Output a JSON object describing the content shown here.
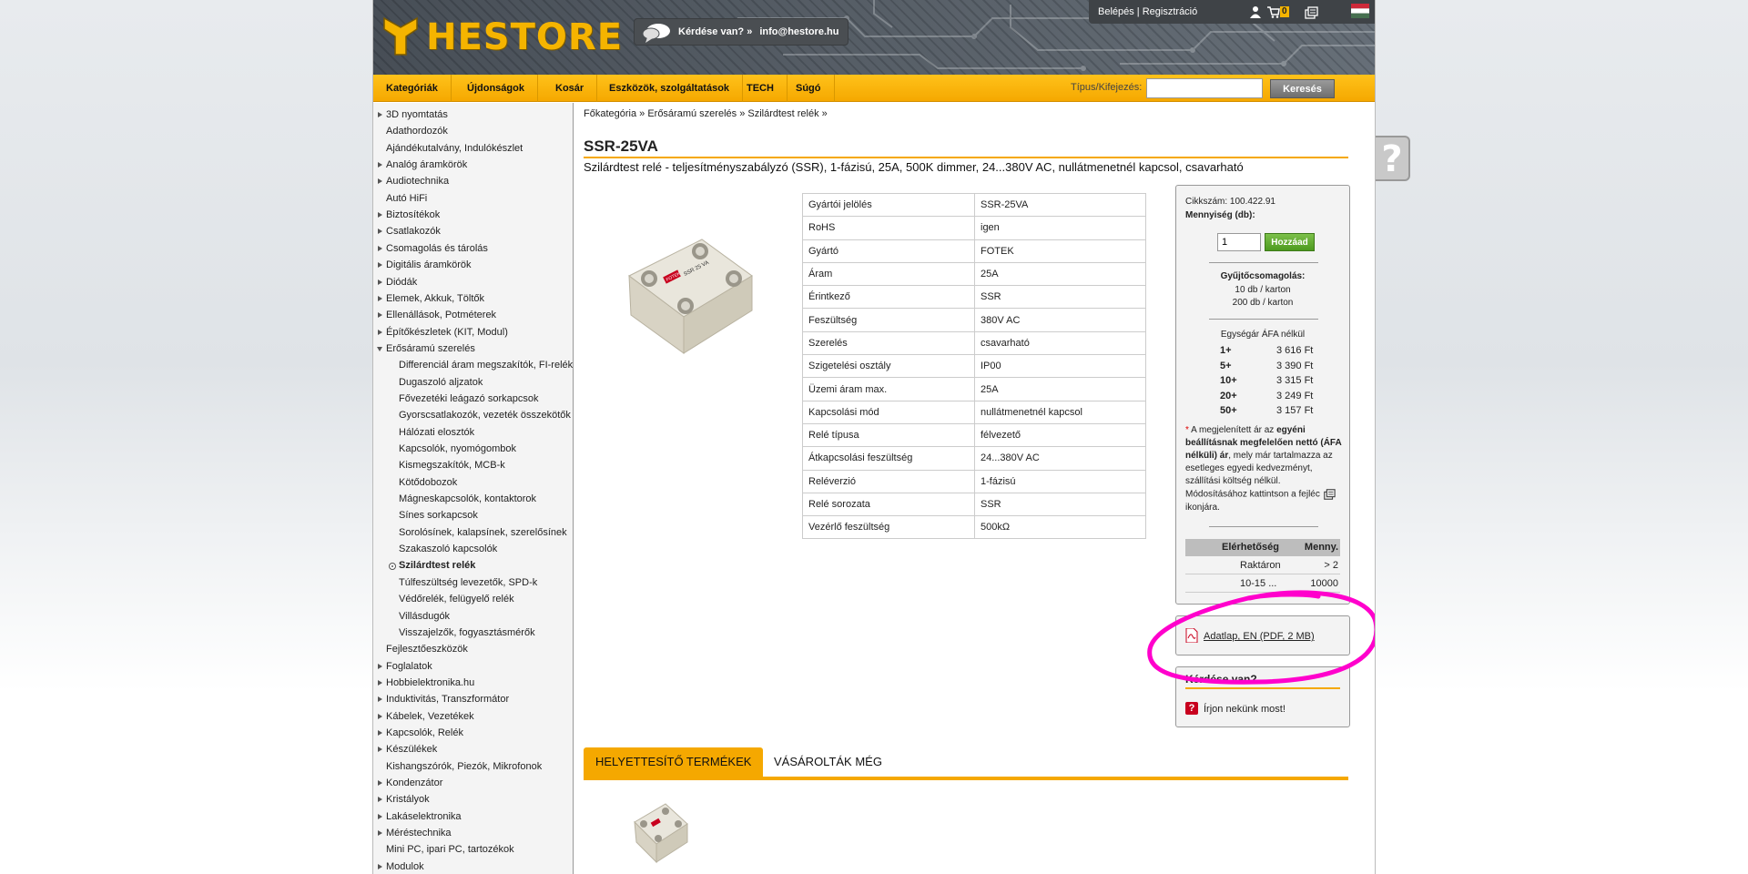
{
  "header": {
    "logo_text": "HESTORE",
    "question_text": "Kérdése van? »",
    "email": "info@hestore.hu",
    "login": "Belépés | Regisztráció",
    "cart_count": "0"
  },
  "nav": {
    "items": [
      "Kategóriák",
      "Újdonságok",
      "Kosár",
      "Eszközök, szolgáltatások",
      "TECH",
      "Súgó"
    ],
    "search_label": "Típus/Kifejezés:",
    "search_value": "",
    "search_button": "Keresés"
  },
  "sidebar": {
    "categories": [
      {
        "label": "3D nyomtatás",
        "arrow": true
      },
      {
        "label": "Adathordozók",
        "arrow": false
      },
      {
        "label": "Ajándékutalvány, Indulókészlet",
        "arrow": false
      },
      {
        "label": "Analóg áramkörök",
        "arrow": true
      },
      {
        "label": "Audiotechnika",
        "arrow": true
      },
      {
        "label": "Autó HiFi",
        "arrow": false
      },
      {
        "label": "Biztosítékok",
        "arrow": true
      },
      {
        "label": "Csatlakozók",
        "arrow": true
      },
      {
        "label": "Csomagolás és tárolás",
        "arrow": true
      },
      {
        "label": "Digitális áramkörök",
        "arrow": true
      },
      {
        "label": "Diódák",
        "arrow": true
      },
      {
        "label": "Elemek, Akkuk, Töltők",
        "arrow": true
      },
      {
        "label": "Ellenállások, Potméterek",
        "arrow": true
      },
      {
        "label": "Építőkészletek (KIT, Modul)",
        "arrow": true
      },
      {
        "label": "Erősáramú szerelés",
        "arrow": "open"
      },
      {
        "label": "Differenciál áram megszakítók, FI-relék",
        "sub": true
      },
      {
        "label": "Dugaszoló aljzatok",
        "sub": true
      },
      {
        "label": "Fővezetéki leágazó sorkapcsok",
        "sub": true
      },
      {
        "label": "Gyorscsatlakozók, vezeték összekötők",
        "sub": true
      },
      {
        "label": "Hálózati elosztók",
        "sub": true
      },
      {
        "label": "Kapcsolók, nyomógombok",
        "sub": true
      },
      {
        "label": "Kismegszakítók, MCB-k",
        "sub": true
      },
      {
        "label": "Kötődobozok",
        "sub": true
      },
      {
        "label": "Mágneskapcsolók, kontaktorok",
        "sub": true
      },
      {
        "label": "Sínes sorkapcsok",
        "sub": true
      },
      {
        "label": "Sorolósínek, kalapsínek, szerelősínek",
        "sub": true
      },
      {
        "label": "Szakaszoló kapcsolók",
        "sub": true
      },
      {
        "label": "Szilárdtest relék",
        "sub": true,
        "active": true
      },
      {
        "label": "Túlfeszültség levezetők, SPD-k",
        "sub": true
      },
      {
        "label": "Védőrelék, felügyelő relék",
        "sub": true
      },
      {
        "label": "Villásdugók",
        "sub": true
      },
      {
        "label": "Visszajelzők, fogyasztásmérők",
        "sub": true
      },
      {
        "label": "Fejlesztőeszközök",
        "arrow": false
      },
      {
        "label": "Foglalatok",
        "arrow": true
      },
      {
        "label": "Hobbielektronika.hu",
        "arrow": true
      },
      {
        "label": "Induktivitás, Transzformátor",
        "arrow": true
      },
      {
        "label": "Kábelek, Vezetékek",
        "arrow": true
      },
      {
        "label": "Kapcsolók, Relék",
        "arrow": true
      },
      {
        "label": "Készülékek",
        "arrow": true
      },
      {
        "label": "Kishangszórók, Piezók, Mikrofonok",
        "arrow": false
      },
      {
        "label": "Kondenzátor",
        "arrow": true
      },
      {
        "label": "Kristályok",
        "arrow": true
      },
      {
        "label": "Lakáselektronika",
        "arrow": true
      },
      {
        "label": "Méréstechnika",
        "arrow": true
      },
      {
        "label": "Mini PC, ipari PC, tartozékok",
        "arrow": false
      },
      {
        "label": "Modulok",
        "arrow": true
      }
    ]
  },
  "breadcrumb": "Főkategória » Erősáramú szerelés » Szilárdtest relék »",
  "product": {
    "title": "SSR-25VA",
    "subtitle": "Szilárdtest relé - teljesítményszabályzó (SSR), 1-fázisú, 25A, 500K dimmer, 24...380V AC, nullátmenetnél kapcsol, csavarható",
    "specs": [
      [
        "Gyártói jelölés",
        "SSR-25VA"
      ],
      [
        "RoHS",
        "igen"
      ],
      [
        "Gyártó",
        "FOTEK"
      ],
      [
        "Áram",
        "25A"
      ],
      [
        "Érintkező",
        "SSR"
      ],
      [
        "Feszültség",
        "380V AC"
      ],
      [
        "Szerelés",
        "csavarható"
      ],
      [
        "Szigetelési osztály",
        "IP00"
      ],
      [
        "Üzemi áram max.",
        "25A"
      ],
      [
        "Kapcsolási mód",
        "nullátmenetnél kapcsol"
      ],
      [
        "Relé típusa",
        "félvezető"
      ],
      [
        "Átkapcsolási feszültség",
        "24...380V AC"
      ],
      [
        "Reléverzió",
        "1-fázisú"
      ],
      [
        "Relé sorozata",
        "SSR"
      ],
      [
        "Vezérlő feszültség",
        "500kΩ"
      ]
    ],
    "img_label": "SSR 25 VA",
    "img_brand": "FOTEK"
  },
  "buybox": {
    "code": "Cikkszám: 100.422.91",
    "qty_label": "Mennyiség (db):",
    "qty_value": "1",
    "add_button": "Hozzáad",
    "bulk_title": "Gyűjtőcsomagolás:",
    "bulk_1": "10 db / karton",
    "bulk_2": "200 db / karton",
    "unit_price_title": "Egységár ÁFA nélkül",
    "prices": [
      {
        "q": "1+",
        "p": "3 616 Ft"
      },
      {
        "q": "5+",
        "p": "3 390 Ft"
      },
      {
        "q": "10+",
        "p": "3 315 Ft"
      },
      {
        "q": "20+",
        "p": "3 249 Ft"
      },
      {
        "q": "50+",
        "p": "3 157 Ft"
      }
    ],
    "note_star": "*",
    "note_a": " A megjelenített ár az ",
    "note_b": "egyéni beállításnak megfelelően nettó (ÁFA nélküli) ár",
    "note_c": ", mely már tartalmazza az esetleges egyedi kedvezményt, szállítási költség nélkül. Módosításához kattintson a fejléc ",
    "note_d": " ikonjára.",
    "avail_head_a": "Elérhetőség",
    "avail_head_b": "Menny.",
    "avail_rows": [
      {
        "a": "Raktáron",
        "b": "> 2"
      },
      {
        "a": "10-15 ...",
        "b": "10000"
      }
    ]
  },
  "datasheet": "Adatlap, EN (PDF, 2 MB)",
  "contact": {
    "title": "Kérdése van?",
    "link": "Írjon nekünk most!"
  },
  "tabs": [
    "HELYETTESÍTŐ TERMÉKEK",
    "VÁSÁROLTÁK MÉG"
  ],
  "help": "?",
  "colors": {
    "accent": "#f5a800",
    "annotation": "#ff00cc",
    "add_button": "#5aa82a"
  }
}
